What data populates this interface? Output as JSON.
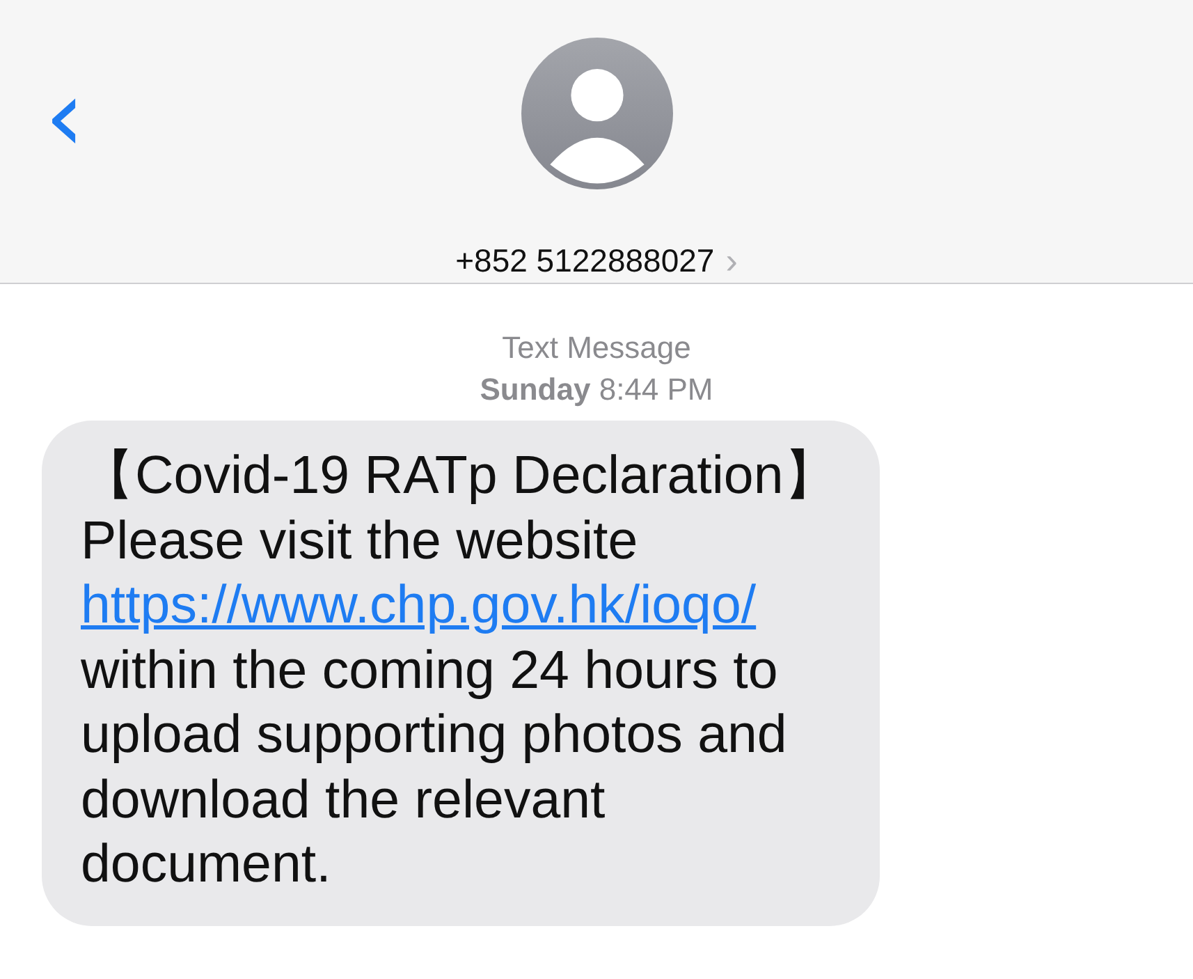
{
  "header": {
    "back_icon": "‹",
    "contact": "+852 5122888027",
    "contact_chevron": "›"
  },
  "meta": {
    "service": "Text Message",
    "day": "Sunday",
    "time": "8:44 PM"
  },
  "messages": [
    {
      "kind": "incoming",
      "parts": [
        {
          "kind": "text",
          "text": "【Covid-19 RATp Declaration】Please visit the website "
        },
        {
          "kind": "link",
          "text": "https://www.chp.gov.hk/ioqo/"
        },
        {
          "kind": "text",
          "text": " within the coming 24 hours to upload supporting photos and download the relevant document."
        }
      ]
    }
  ]
}
